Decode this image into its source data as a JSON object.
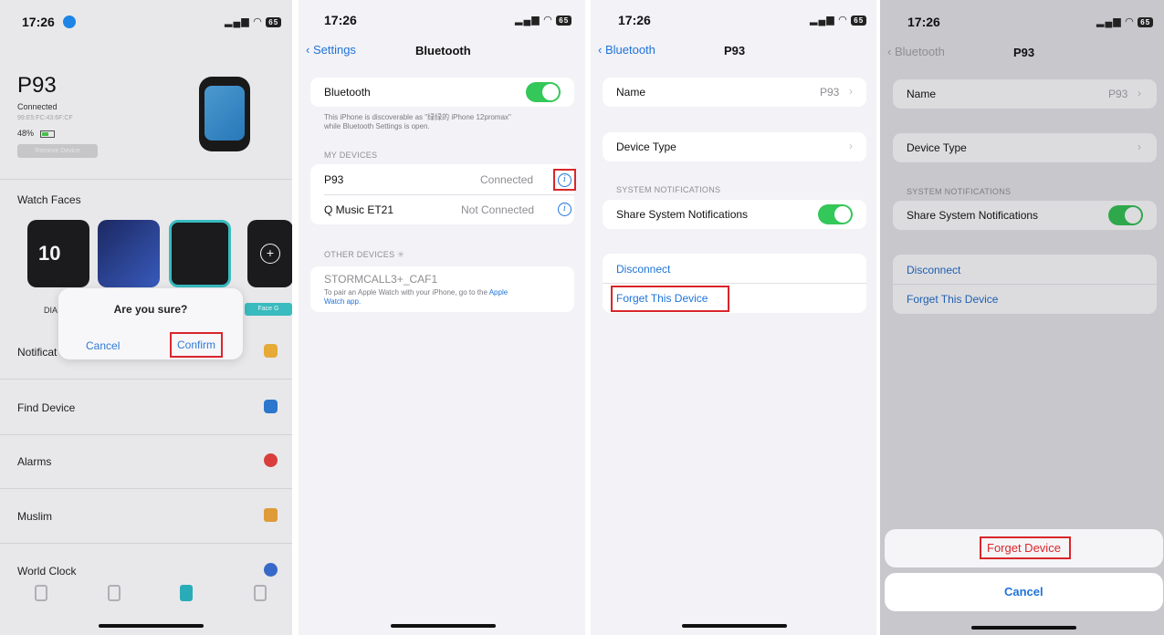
{
  "status": {
    "time": "17:26",
    "battery": "65"
  },
  "screen1": {
    "device_name": "P93",
    "connection_state": "Connected",
    "mac": "99:E5:FC:43:6F:CF",
    "battery": "48%",
    "remove_button": "Remove Device",
    "watch_faces_title": "Watch Faces",
    "face_label": "DIA",
    "face_right_label": "Face G",
    "menu": [
      {
        "label": "Notificat",
        "icon": "chat-icon",
        "color": "#f0b23a"
      },
      {
        "label": "Find Device",
        "icon": "search-icon",
        "color": "#2f7bd6"
      },
      {
        "label": "Alarms",
        "icon": "clock-icon",
        "color": "#e2403f"
      },
      {
        "label": "Muslim",
        "icon": "mosque-icon",
        "color": "#e8a23a"
      },
      {
        "label": "World Clock",
        "icon": "globe-icon",
        "color": "#3a6fd1"
      }
    ],
    "dialog": {
      "title": "Are you sure?",
      "cancel": "Cancel",
      "confirm": "Confirm"
    }
  },
  "screen2": {
    "back": "Settings",
    "title": "Bluetooth",
    "bluetooth_label": "Bluetooth",
    "bluetooth_on": true,
    "discoverable_hint_1": "This iPhone is discoverable as \"绿绿的 iPhone 12promax\"",
    "discoverable_hint_2": "while Bluetooth Settings is open.",
    "my_devices_header": "MY DEVICES",
    "devices": [
      {
        "name": "P93",
        "status": "Connected"
      },
      {
        "name": "Q Music ET21",
        "status": "Not Connected"
      }
    ],
    "other_devices_header": "OTHER DEVICES",
    "other_device": "STORMCALL3+_CAF1",
    "pair_hint_1": "To pair an Apple Watch with your iPhone, go to the",
    "pair_hint_link_1": "Apple",
    "pair_hint_link_2": "Watch app."
  },
  "screen3": {
    "back": "Bluetooth",
    "title": "P93",
    "name_label": "Name",
    "name_value": "P93",
    "device_type_label": "Device Type",
    "system_notifications_header": "SYSTEM NOTIFICATIONS",
    "share_notifications_label": "Share System Notifications",
    "share_on": true,
    "disconnect": "Disconnect",
    "forget": "Forget This Device"
  },
  "screen4": {
    "back": "Bluetooth",
    "title": "P93",
    "name_label": "Name",
    "name_value": "P93",
    "device_type_label": "Device Type",
    "system_notifications_header": "SYSTEM NOTIFICATIONS",
    "share_notifications_label": "Share System Notifications",
    "disconnect": "Disconnect",
    "forget": "Forget This Device",
    "sheet_forget": "Forget Device",
    "sheet_cancel": "Cancel"
  }
}
